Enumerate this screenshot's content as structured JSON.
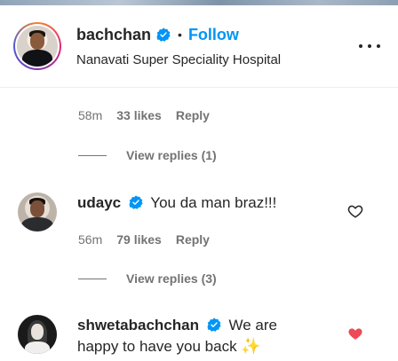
{
  "post": {
    "username": "bachchan",
    "follow_label": "Follow",
    "separator": "•",
    "location": "Nanavati Super Speciality Hospital"
  },
  "thread1": {
    "time": "58m",
    "likes": "33 likes",
    "reply_label": "Reply",
    "view_replies": "View replies (1)"
  },
  "comments": [
    {
      "username": "udayc",
      "text": "You da man braz!!!",
      "time": "56m",
      "likes": "79 likes",
      "reply_label": "Reply",
      "view_replies": "View replies (3)",
      "liked": false
    },
    {
      "username": "shwetabachchan",
      "text_line1": "We are",
      "text_line2": "happy to have you back",
      "emoji": "✨",
      "liked": true
    }
  ],
  "colors": {
    "accent": "#0095f6",
    "verified": "#0095f6",
    "muted": "#737373",
    "like_red": "#ed4956"
  },
  "icons": {
    "verified": "verified-badge-icon",
    "more": "more-options-icon",
    "heart_outline": "heart-outline-icon",
    "heart_filled": "heart-filled-icon"
  }
}
